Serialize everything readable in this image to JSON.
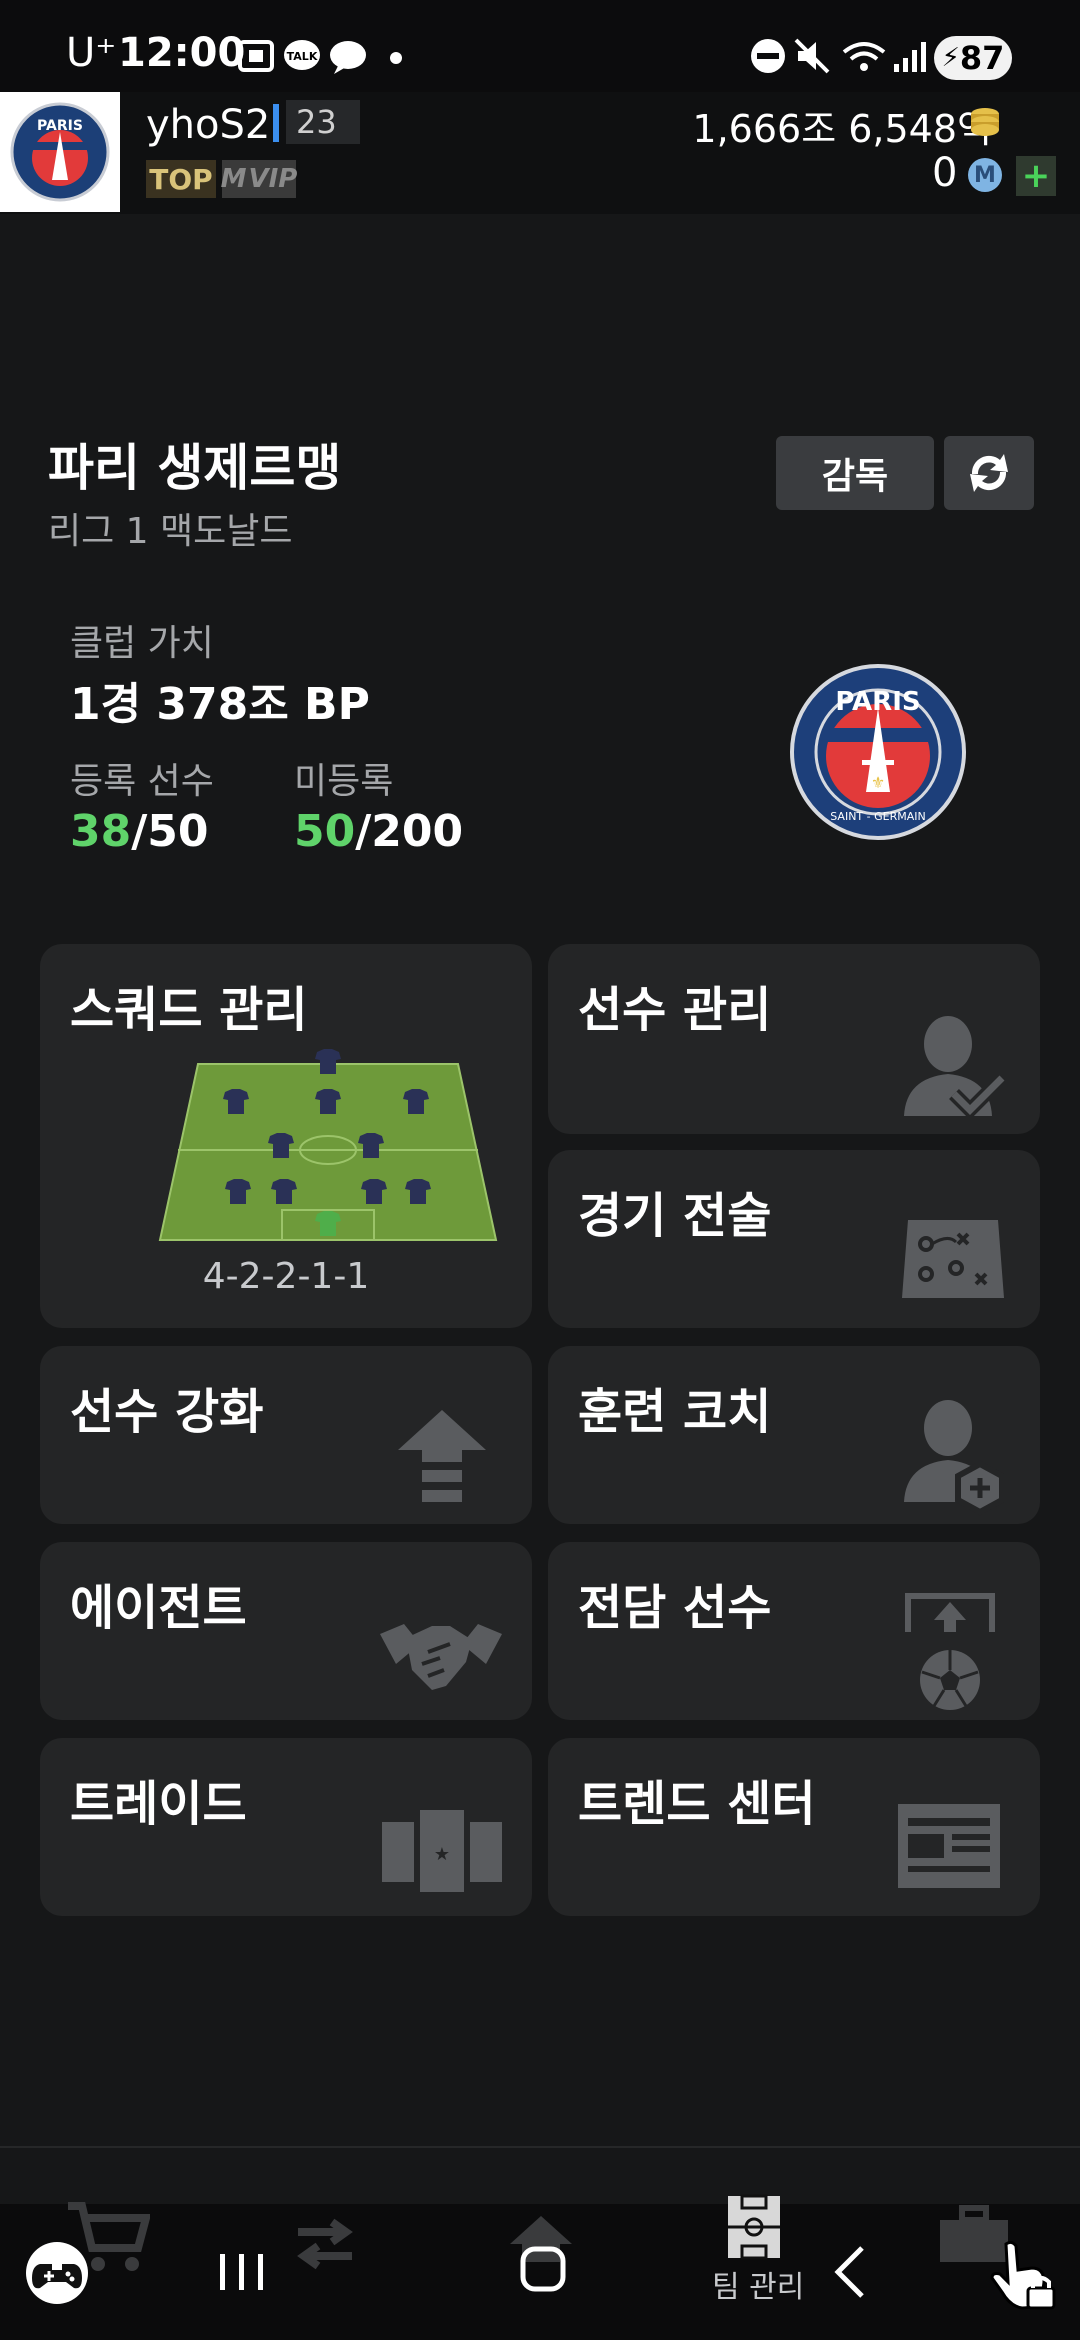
{
  "status_bar": {
    "carrier": "U⁺",
    "time": "12:00",
    "battery": "87"
  },
  "header": {
    "username": "yhoS2",
    "level": "23",
    "badge_top": "TOP",
    "badge_vip": "VIP",
    "badge_vip_prefix": "M",
    "bp_balance": "1,666조 6,548억",
    "m_coin_count": "0",
    "m_coin_symbol": "M",
    "add": "+"
  },
  "club": {
    "name": "파리 생제르맹",
    "league": "리그 1 맥도날드",
    "manager_button": "감독",
    "value_label": "클럽 가치",
    "value": "1경 378조 BP",
    "registered_label": "등록 선수",
    "registered_current": "38",
    "registered_max": "/50",
    "unregistered_label": "미등록",
    "unregistered_current": "50",
    "unregistered_max": "/200",
    "logo_text_top": "PARIS",
    "logo_text_bottom": "SAINT - GERMAIN"
  },
  "menu": {
    "squad": "스쿼드 관리",
    "formation": "4-2-2-1-1",
    "players": "선수 관리",
    "tactics": "경기 전술",
    "upgrade": "선수 강화",
    "coach": "훈련 코치",
    "agent": "에이전트",
    "exclusive": "전담 선수",
    "trade": "트레이드",
    "trend": "트렌드 센터"
  },
  "bottom_nav": {
    "team_manage": "팀 관리"
  },
  "colors": {
    "accent_green": "#5fd36a",
    "accent_blue": "#3b8ff0",
    "card_bg": "#242526",
    "page_bg": "#161718"
  }
}
